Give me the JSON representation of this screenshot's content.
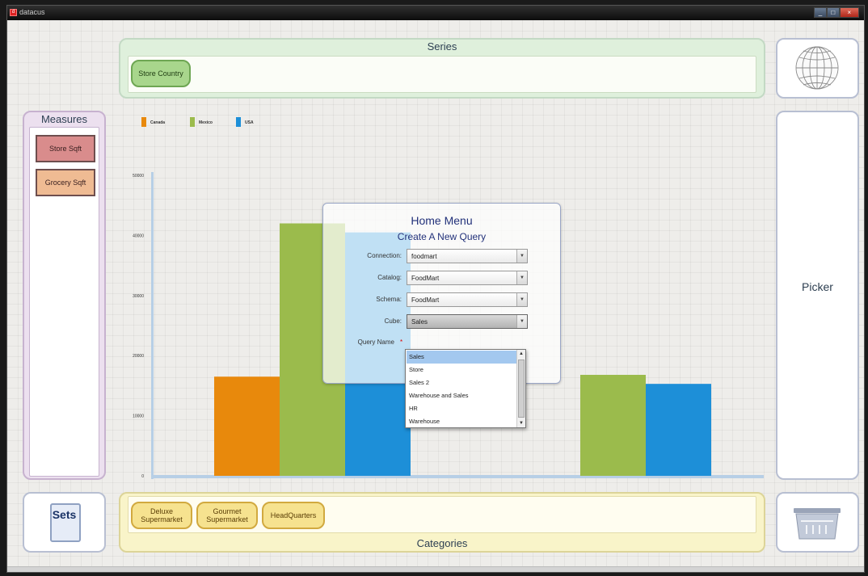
{
  "window": {
    "title": "datacus"
  },
  "series": {
    "title": "Series",
    "chips": [
      "Store Country"
    ]
  },
  "measures": {
    "title": "Measures",
    "items": [
      "Store Sqft",
      "Grocery Sqft"
    ]
  },
  "picker": {
    "label": "Picker"
  },
  "sets": {
    "label": "Sets"
  },
  "categories": {
    "title": "Categories",
    "chips": [
      [
        "Deluxe",
        "Supermarket"
      ],
      [
        "Gourmet",
        "Supermarket"
      ],
      [
        "HeadQuarters"
      ]
    ]
  },
  "dialog": {
    "title": "Home Menu",
    "subtitle": "Create A New Query",
    "fields": [
      {
        "label": "Connection:",
        "value": "foodmart"
      },
      {
        "label": "Catalog:",
        "value": "FoodMart"
      },
      {
        "label": "Schema:",
        "value": "FoodMart"
      },
      {
        "label": "Cube:",
        "value": "Sales"
      }
    ],
    "query_name_label": "Query Name",
    "required_mark": "*",
    "cube_options": [
      "Sales",
      "Store",
      "Sales 2",
      "Warehouse and Sales",
      "HR",
      "Warehouse"
    ],
    "selected_option": "Sales"
  },
  "colors": {
    "canada": "#e8890c",
    "mexico": "#9bbb4c",
    "usa": "#1d8fd8"
  },
  "chart_data": {
    "type": "bar",
    "categories": [
      "Deluxe Supermarket",
      "Gourmet Supermarket"
    ],
    "series": [
      {
        "name": "Canada",
        "color": "#e8890c",
        "values": [
          16500,
          null
        ]
      },
      {
        "name": "Mexico",
        "color": "#9bbb4c",
        "values": [
          42000,
          16800
        ]
      },
      {
        "name": "USA",
        "color": "#1d8fd8",
        "values": [
          40500,
          15300
        ]
      }
    ],
    "y_ticks": [
      "0",
      "10000",
      "20000",
      "30000",
      "40000",
      "50000"
    ],
    "ylim": [
      0,
      50000
    ],
    "legend": "top-left"
  }
}
